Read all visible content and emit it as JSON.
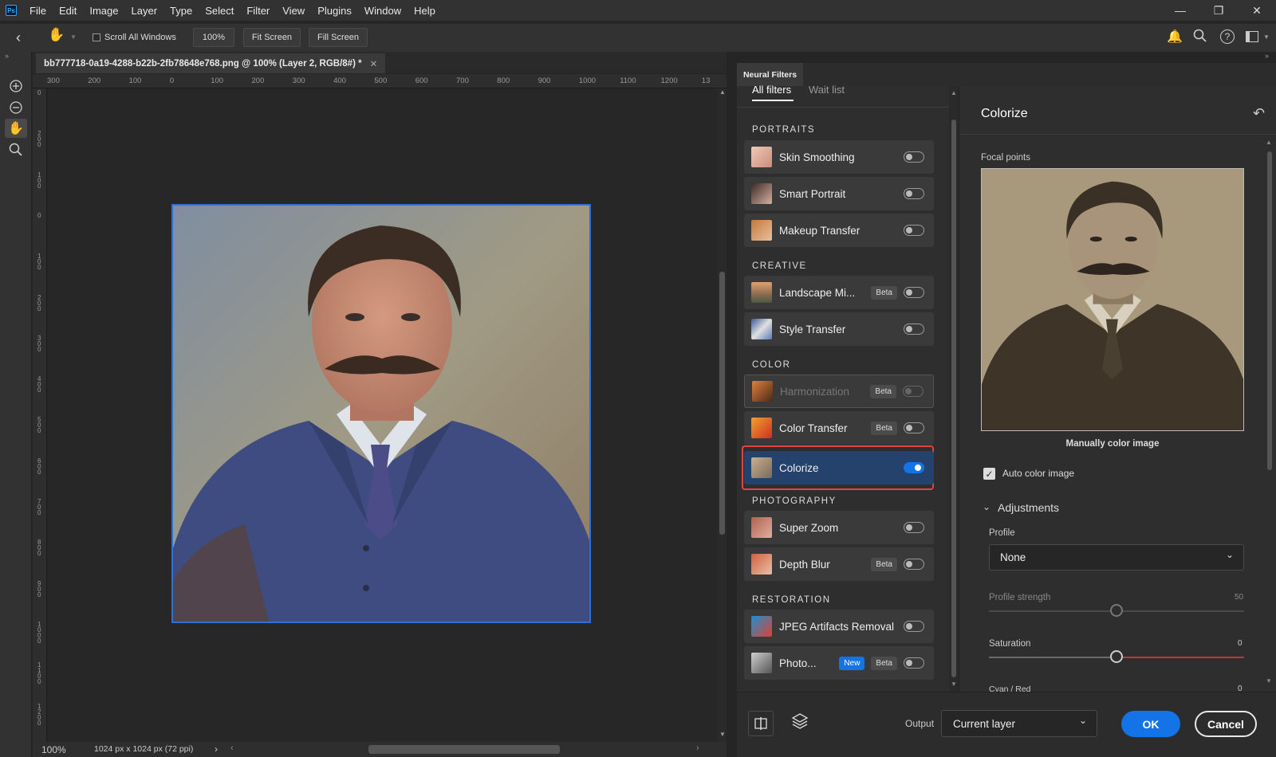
{
  "menubar": {
    "logo": "Ps",
    "items": [
      "File",
      "Edit",
      "Image",
      "Layer",
      "Type",
      "Select",
      "Filter",
      "View",
      "Plugins",
      "Window",
      "Help"
    ]
  },
  "options": {
    "scroll_all_windows": "Scroll All Windows",
    "zoom_button": "100%",
    "fit_screen": "Fit Screen",
    "fill_screen": "Fill Screen"
  },
  "document": {
    "tab_title": "bb777718-0a19-4288-b22b-2fb78648e768.png @ 100% (Layer 2, RGB/8#) *",
    "zoom": "100%",
    "dimensions": "1024 px x 1024 px (72 ppi)"
  },
  "ruler": {
    "top_labels": [
      "300",
      "200",
      "100",
      "0",
      "100",
      "200",
      "300",
      "400",
      "500",
      "600",
      "700",
      "800",
      "900",
      "1000",
      "1100",
      "1200",
      "13"
    ],
    "left_labels": [
      "0",
      "2 0 0",
      "1 0 0",
      "0",
      "1 0 0",
      "2 0 0",
      "3 0 0",
      "4 0 0",
      "5 0 0",
      "6 0 0",
      "7 0 0",
      "8 0 0",
      "9 0 0",
      "1 0 0 0",
      "1 1 0 0",
      "1 2 0 0"
    ]
  },
  "neural_filters": {
    "panel_title": "Neural Filters",
    "tabs": [
      "All filters",
      "Wait list"
    ],
    "sections": [
      {
        "title": "PORTRAITS",
        "filters": [
          {
            "label": "Skin Smoothing",
            "badges": [],
            "on": false
          },
          {
            "label": "Smart Portrait",
            "badges": [],
            "on": false
          },
          {
            "label": "Makeup Transfer",
            "badges": [],
            "on": false
          }
        ]
      },
      {
        "title": "CREATIVE",
        "filters": [
          {
            "label": "Landscape Mi...",
            "badges": [
              "Beta"
            ],
            "on": false
          },
          {
            "label": "Style Transfer",
            "badges": [],
            "on": false
          }
        ]
      },
      {
        "title": "COLOR",
        "filters": [
          {
            "label": "Harmonization",
            "badges": [
              "Beta"
            ],
            "on": false,
            "disabled": true
          },
          {
            "label": "Color Transfer",
            "badges": [
              "Beta"
            ],
            "on": false
          },
          {
            "label": "Colorize",
            "badges": [],
            "on": true,
            "active": true
          }
        ]
      },
      {
        "title": "PHOTOGRAPHY",
        "filters": [
          {
            "label": "Super Zoom",
            "badges": [],
            "on": false
          },
          {
            "label": "Depth Blur",
            "badges": [
              "Beta"
            ],
            "on": false
          }
        ]
      },
      {
        "title": "RESTORATION",
        "filters": [
          {
            "label": "JPEG Artifacts Removal",
            "badges": [],
            "on": false
          },
          {
            "label": "Photo...",
            "badges": [
              "New",
              "Beta"
            ],
            "on": false
          }
        ]
      }
    ]
  },
  "settings": {
    "title": "Colorize",
    "focal_points": "Focal points",
    "manual_caption": "Manually color image",
    "auto_color": "Auto color image",
    "adjustments": "Adjustments",
    "profile_label": "Profile",
    "profile_value": "None",
    "profile_strength_label": "Profile strength",
    "profile_strength_value": "50",
    "saturation_label": "Saturation",
    "saturation_value": "0",
    "cyan_red_label": "Cyan / Red",
    "cyan_red_value": "0"
  },
  "bottom": {
    "output_label": "Output",
    "output_value": "Current layer",
    "ok": "OK",
    "cancel": "Cancel"
  },
  "colors": {
    "accent": "#1473e6",
    "highlight_border": "#e0463c"
  }
}
